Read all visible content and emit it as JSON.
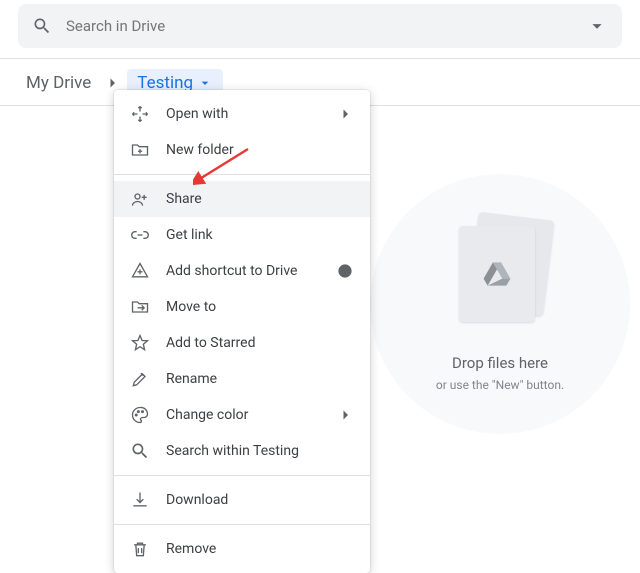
{
  "search": {
    "placeholder": "Search in Drive"
  },
  "breadcrumb": {
    "root": "My Drive",
    "current": "Testing"
  },
  "drop": {
    "title": "Drop files here",
    "subtitle": "or use the \"New\" button."
  },
  "menu": {
    "open_with": "Open with",
    "new_folder": "New folder",
    "share": "Share",
    "get_link": "Get link",
    "add_shortcut": "Add shortcut to Drive",
    "move_to": "Move to",
    "add_starred": "Add to Starred",
    "rename": "Rename",
    "change_color": "Change color",
    "search_within": "Search within Testing",
    "download": "Download",
    "remove": "Remove"
  }
}
